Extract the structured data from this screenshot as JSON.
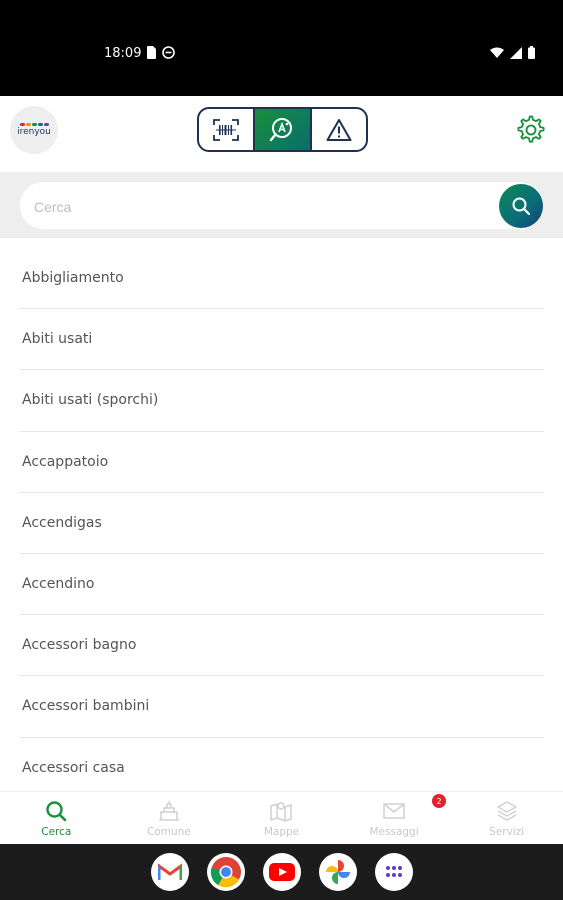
{
  "status_bar": {
    "time": "18:09",
    "left_icons": [
      "sim-card-icon",
      "do-not-disturb-icon"
    ],
    "right_icons": [
      "wifi-icon",
      "signal-icon",
      "battery-icon"
    ]
  },
  "header": {
    "logo_text": "irenyou",
    "mode_switch": [
      {
        "name": "barcode-scan-icon",
        "active": false
      },
      {
        "name": "search-waste-icon",
        "active": true
      },
      {
        "name": "report-warning-icon",
        "active": false
      }
    ],
    "settings_icon": "gear-icon"
  },
  "search": {
    "placeholder": "Cerca",
    "button_icon": "search-icon"
  },
  "list": {
    "items": [
      "Abbigliamento",
      "Abiti usati",
      "Abiti usati (sporchi)",
      "Accappatoio",
      "Accendigas",
      "Accendino",
      "Accessori bagno",
      "Accessori bambini",
      "Accessori casa"
    ]
  },
  "bottom_nav": {
    "items": [
      {
        "label": "Cerca",
        "icon": "search-icon",
        "active": true
      },
      {
        "label": "Comune",
        "icon": "town-hall-icon",
        "active": false
      },
      {
        "label": "Mappe",
        "icon": "map-icon",
        "active": false
      },
      {
        "label": "Messaggi",
        "icon": "mail-icon",
        "active": false
      },
      {
        "label": "Servizi",
        "icon": "layers-icon",
        "active": false
      }
    ],
    "messages_badge": "2"
  },
  "dock": {
    "apps": [
      "gmail-icon",
      "chrome-icon",
      "youtube-icon",
      "photos-icon",
      "app-drawer-icon"
    ]
  },
  "colors": {
    "brand_green": "#1a8f3a",
    "brand_navy": "#1f3152",
    "badge_red": "#e4202b"
  }
}
